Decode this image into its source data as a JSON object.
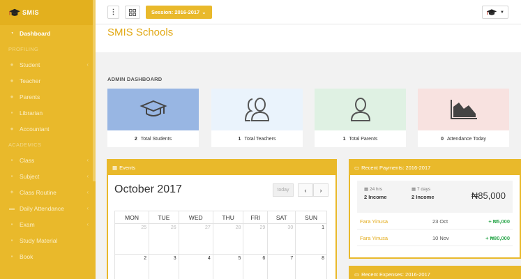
{
  "brand": {
    "logo_text": "SMIS"
  },
  "sidebar": {
    "items": [
      {
        "label": "Dashboard",
        "icon": "dashboard-icon",
        "active": true
      },
      {
        "section": "PROFILING"
      },
      {
        "label": "Student",
        "icon": "student-icon",
        "caret": true
      },
      {
        "label": "Teacher",
        "icon": "teacher-icon"
      },
      {
        "label": "Parents",
        "icon": "parents-icon"
      },
      {
        "label": "Librarian",
        "icon": "librarian-icon"
      },
      {
        "label": "Accountant",
        "icon": "accountant-icon"
      },
      {
        "section": "ACADEMICS"
      },
      {
        "label": "Class",
        "icon": "class-icon",
        "caret": true
      },
      {
        "label": "Subject",
        "icon": "subject-icon",
        "caret": true
      },
      {
        "label": "Class Routine",
        "icon": "routine-icon",
        "caret": true
      },
      {
        "label": "Daily Attendance",
        "icon": "attendance-icon",
        "caret": true
      },
      {
        "label": "Exam",
        "icon": "exam-icon",
        "caret": true
      },
      {
        "label": "Study Material",
        "icon": "study-material-icon"
      },
      {
        "label": "Book",
        "icon": "book-icon"
      }
    ]
  },
  "topbar": {
    "session_label": "Session: 2016-2017",
    "user_badge": "⌄"
  },
  "page": {
    "title": "SMIS Schools"
  },
  "dashboard": {
    "label": "ADMIN DASHBOARD",
    "stats": [
      {
        "num": "2",
        "label": "Total Students",
        "icon": "graduation-cap-icon",
        "bg": "#98b6e3"
      },
      {
        "num": "1",
        "label": "Total Teachers",
        "icon": "users-icon",
        "bg": "#eaf3fc"
      },
      {
        "num": "1",
        "label": "Total Parents",
        "icon": "user-icon",
        "bg": "#dff1e3"
      },
      {
        "num": "0",
        "label": "Attendance Today",
        "icon": "area-chart-icon",
        "bg": "#f8e2e0"
      }
    ]
  },
  "events": {
    "title": "Events",
    "calendar_title": "October 2017",
    "today_label": "today",
    "prev_label": "‹",
    "next_label": "›",
    "weekdays": [
      "MON",
      "TUE",
      "WED",
      "THU",
      "FRI",
      "SAT",
      "SUN"
    ],
    "weeks": [
      [
        "25",
        "26",
        "27",
        "28",
        "29",
        "30",
        "1"
      ],
      [
        "2",
        "3",
        "4",
        "5",
        "6",
        "7",
        "8"
      ]
    ]
  },
  "payments": {
    "title": "Recent Payments: 2016-2017",
    "period1_label": "24 hrs",
    "period1_value": "2 Income",
    "period2_label": "7 days",
    "period2_value": "2 Income",
    "total": "₦85,000",
    "rows": [
      {
        "name": "Fara Yinusa",
        "date": "23 Oct",
        "amount": "+ ₦5,000"
      },
      {
        "name": "Fara Yinusa",
        "date": "10 Nov",
        "amount": "+ ₦80,000"
      }
    ]
  },
  "expenses": {
    "title": "Recent Expenses: 2016-2017"
  },
  "colors": {
    "brand": "#e9b92b",
    "title": "#e2a916",
    "positive": "#2fa84f"
  }
}
